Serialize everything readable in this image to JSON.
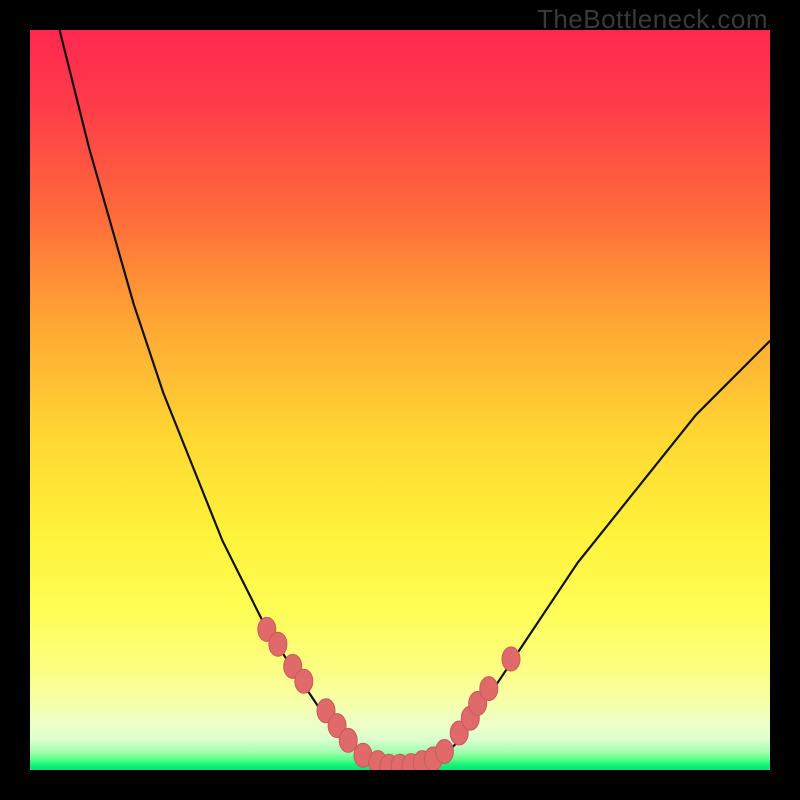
{
  "watermark": "TheBottleneck.com",
  "colors": {
    "frame": "#000000",
    "curve": "#111111",
    "marker_fill": "#e06a6a",
    "marker_stroke": "#c85a5a"
  },
  "chart_data": {
    "type": "line",
    "title": "",
    "xlabel": "",
    "ylabel": "",
    "xlim": [
      0,
      100
    ],
    "ylim": [
      0,
      100
    ],
    "grid": false,
    "legend": false,
    "curve": {
      "description": "V-shaped bottleneck curve (y = percent bottleneck, lower is better)",
      "x": [
        4,
        6,
        8,
        10,
        12,
        14,
        16,
        18,
        20,
        22,
        24,
        26,
        28,
        30,
        32,
        34,
        36,
        38,
        40,
        42,
        44,
        46,
        48,
        50,
        52,
        54,
        56,
        58,
        60,
        62,
        64,
        66,
        70,
        74,
        78,
        82,
        86,
        90,
        94,
        98,
        100
      ],
      "y": [
        100,
        92,
        84,
        77,
        70,
        63,
        57,
        51,
        46,
        41,
        36,
        31,
        27,
        23,
        19,
        16,
        13,
        10,
        7,
        5,
        3,
        1.5,
        0.7,
        0.3,
        0.3,
        0.7,
        2,
        4,
        7,
        10,
        13,
        16,
        22,
        28,
        33,
        38,
        43,
        48,
        52,
        56,
        58
      ]
    },
    "markers": {
      "x": [
        32,
        33.5,
        35.5,
        37,
        40,
        41.5,
        43,
        45,
        47,
        48.5,
        50,
        51.5,
        53,
        54.5,
        56,
        58,
        59.5,
        60.5,
        62,
        65
      ],
      "y": [
        19,
        17,
        14,
        12,
        8,
        6,
        4,
        2,
        1,
        0.5,
        0.5,
        0.6,
        1,
        1.5,
        2.5,
        5,
        7,
        9,
        11,
        15
      ]
    }
  }
}
